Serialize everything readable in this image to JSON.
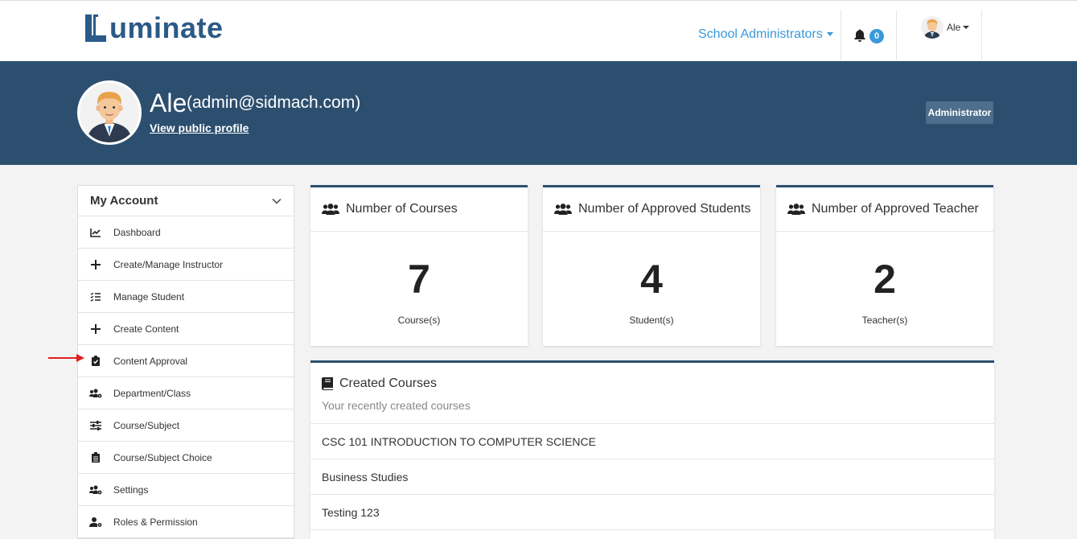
{
  "header": {
    "logo_text": "uminate",
    "role_menu_label": "School Administrators",
    "notification_count": "0",
    "user_name": "Ale"
  },
  "profile": {
    "name": "Ale",
    "email": "(admin@sidmach.com)",
    "public_profile_link": "View public profile",
    "role_badge": "Administrator"
  },
  "sidebar": {
    "title": "My Account",
    "items": [
      {
        "label": "Dashboard",
        "icon": "chart-line-icon"
      },
      {
        "label": "Create/Manage Instructor",
        "icon": "plus-icon"
      },
      {
        "label": "Manage Student",
        "icon": "tasks-icon"
      },
      {
        "label": "Create Content",
        "icon": "plus-icon"
      },
      {
        "label": "Content Approval",
        "icon": "clipboard-check-icon"
      },
      {
        "label": "Department/Class",
        "icon": "users-cog-icon"
      },
      {
        "label": "Course/Subject",
        "icon": "sliders-icon"
      },
      {
        "label": "Course/Subject Choice",
        "icon": "clipboard-list-icon"
      },
      {
        "label": "Settings",
        "icon": "users-cog-icon"
      },
      {
        "label": "Roles & Permission",
        "icon": "user-cog-icon"
      }
    ]
  },
  "stats": [
    {
      "title": "Number of Courses",
      "value": "7",
      "unit": "Course(s)"
    },
    {
      "title": "Number of Approved Students",
      "value": "4",
      "unit": "Student(s)"
    },
    {
      "title": "Number of Approved Teacher",
      "value": "2",
      "unit": "Teacher(s)"
    }
  ],
  "created_courses": {
    "title": "Created Courses",
    "subtitle": "Your recently created courses",
    "rows": [
      "CSC 101 INTRODUCTION TO COMPUTER SCIENCE",
      "Business Studies",
      "Testing 123"
    ]
  },
  "colors": {
    "banner": "#2c4f6f",
    "accent": "#3a9ad9",
    "logo": "#2c5a87",
    "annotation_arrow": "#e02020"
  }
}
